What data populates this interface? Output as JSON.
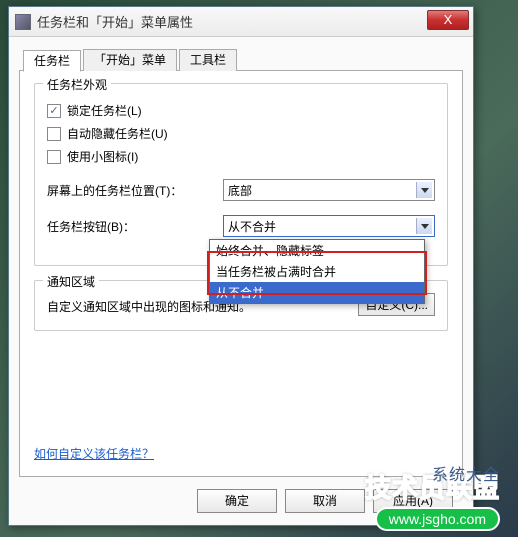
{
  "title": "任务栏和「开始」菜单属性",
  "close_glyph": "X",
  "tabs": [
    "任务栏",
    "「开始」菜单",
    "工具栏"
  ],
  "group_appearance": {
    "title": "任务栏外观",
    "lock_label": "锁定任务栏(L)",
    "autohide_label": "自动隐藏任务栏(U)",
    "smallicons_label": "使用小图标(I)",
    "position_label": "屏幕上的任务栏位置(T)：",
    "position_value": "底部",
    "buttons_label": "任务栏按钮(B)：",
    "buttons_value": "从不合并",
    "buttons_options": [
      "始终合并、隐藏标签",
      "当任务栏被占满时合并",
      "从不合并"
    ]
  },
  "group_notify": {
    "title": "通知区域",
    "desc": "自定义通知区域中出现的图标和通知。",
    "custom_btn": "自定义(C)..."
  },
  "help_link": "如何自定义该任务栏？",
  "buttons": {
    "ok": "确定",
    "cancel": "取消",
    "apply": "应用(A)"
  },
  "watermark": {
    "line1": "技术员联盟",
    "line2": "www.jsgho.com",
    "side": "系统大全"
  }
}
